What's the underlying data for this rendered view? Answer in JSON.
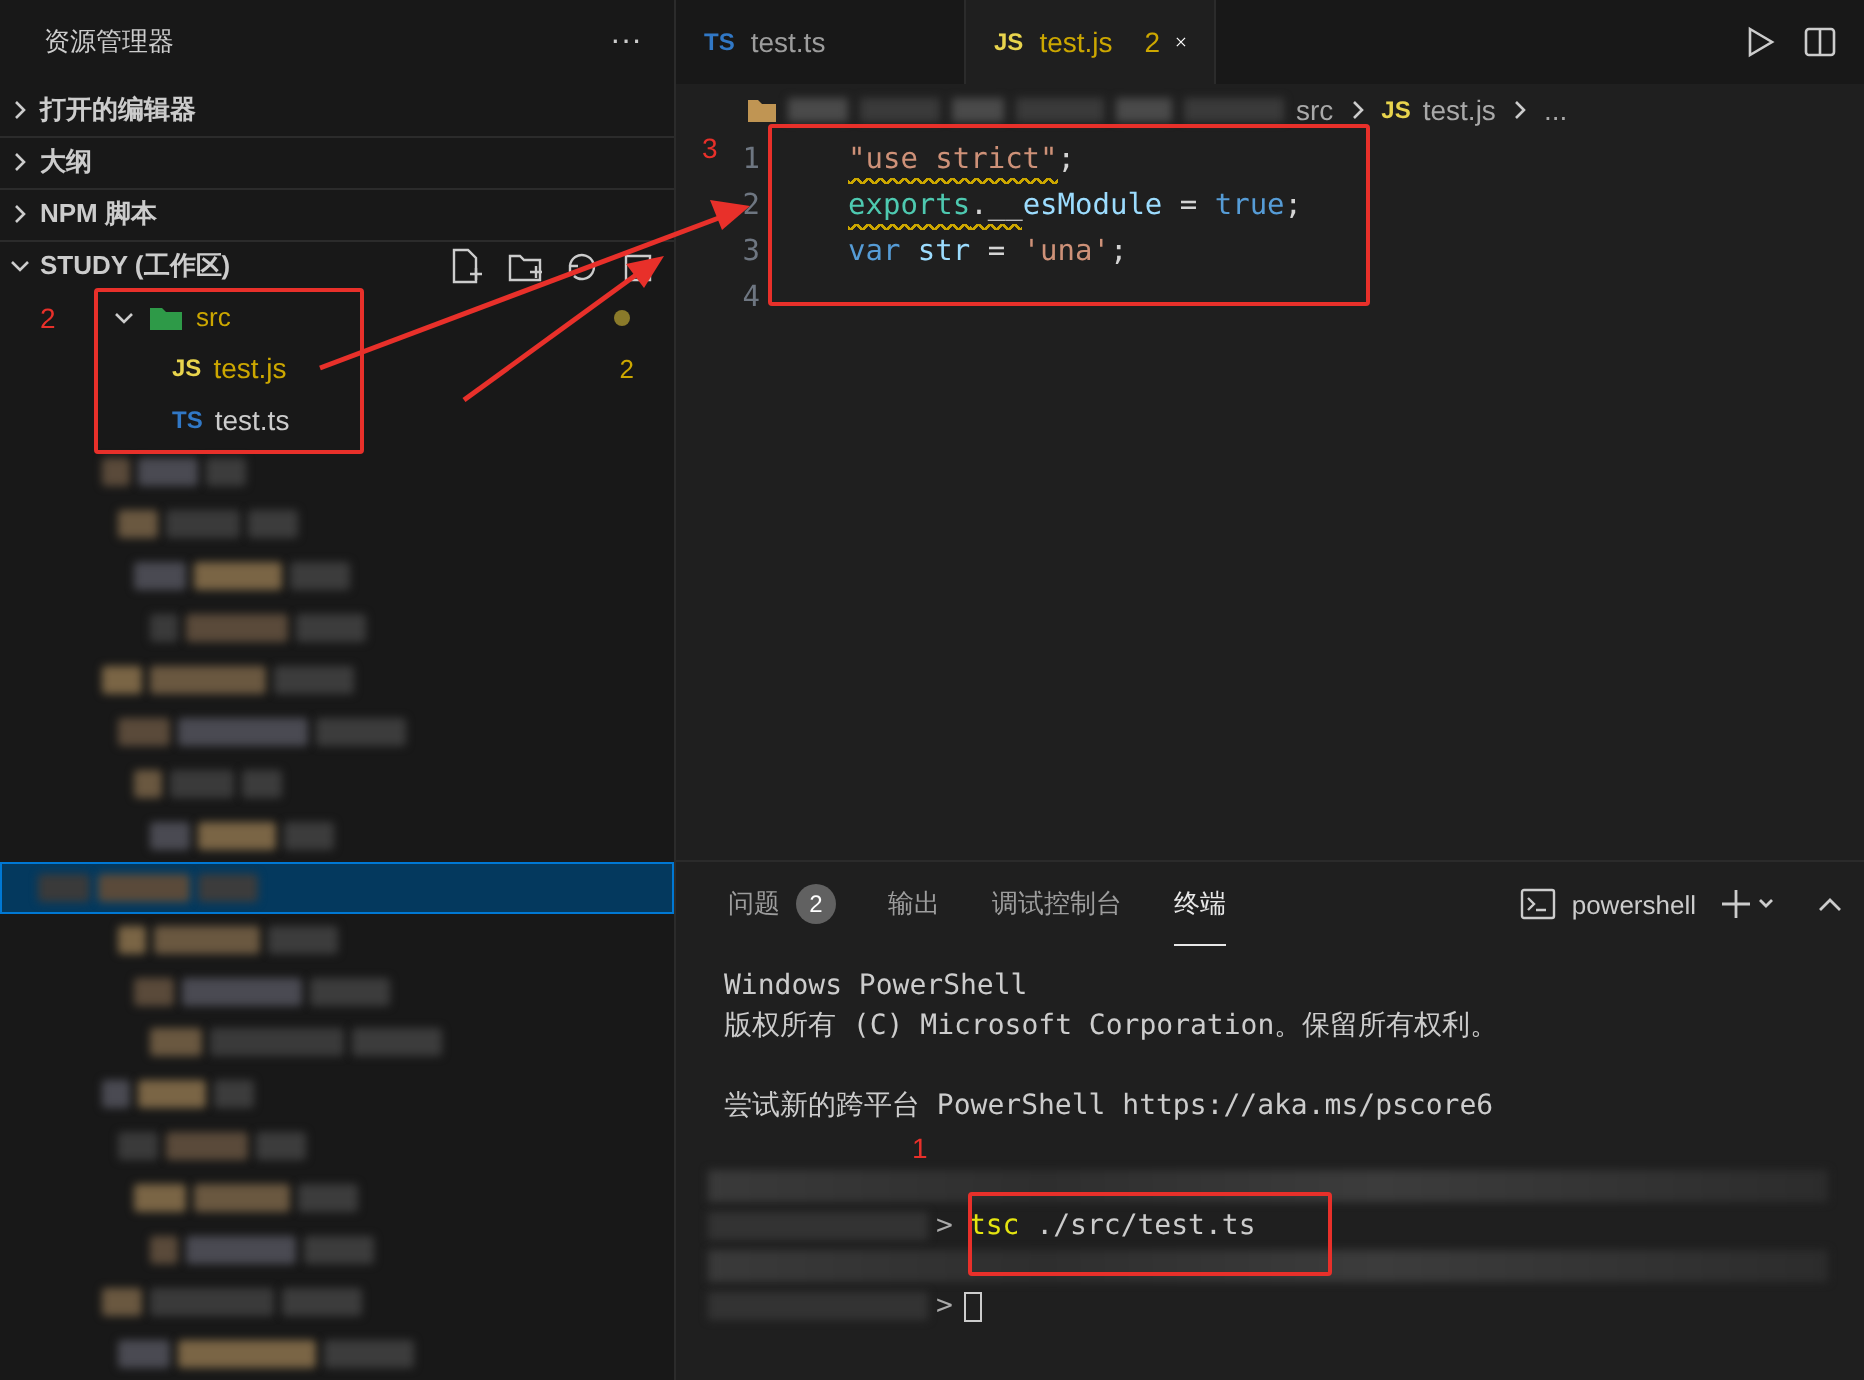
{
  "sidebar": {
    "title": "资源管理器",
    "more": "···",
    "sections": [
      {
        "label": "打开的编辑器",
        "expanded": false
      },
      {
        "label": "大纲",
        "expanded": false
      },
      {
        "label": "NPM 脚本",
        "expanded": false
      }
    ],
    "workspace": {
      "label": "STUDY (工作区)",
      "expanded": true,
      "tree": [
        {
          "name": "src",
          "kind": "folder",
          "expanded": true,
          "modified": true,
          "children": [
            {
              "name": "test.js",
              "kind": "js",
              "icon_label": "JS",
              "badge": "2"
            },
            {
              "name": "test.ts",
              "kind": "ts",
              "icon_label": "TS"
            }
          ]
        }
      ]
    },
    "blurred_rows": [
      {
        "selected": false
      },
      {
        "selected": false
      },
      {
        "selected": false
      },
      {
        "selected": false
      },
      {
        "selected": false
      },
      {
        "selected": false
      },
      {
        "selected": false
      },
      {
        "selected": false
      },
      {
        "selected": true
      },
      {
        "selected": false
      },
      {
        "selected": false
      },
      {
        "selected": false
      },
      {
        "selected": false
      },
      {
        "selected": false
      },
      {
        "selected": false
      },
      {
        "selected": false
      },
      {
        "selected": false
      },
      {
        "selected": false
      }
    ]
  },
  "editor": {
    "tabs": [
      {
        "icon_label": "TS",
        "kind": "ts",
        "label": "test.ts",
        "selected": false
      },
      {
        "icon_label": "JS",
        "kind": "js",
        "label": "test.js",
        "badge": "2",
        "selected": true
      }
    ],
    "breadcrumb": [
      {
        "text": "src"
      },
      {
        "icon_label": "JS",
        "text": "test.js"
      },
      {
        "text": "..."
      }
    ],
    "lines": [
      {
        "number": "1",
        "tokens": [
          {
            "text": "\"use strict\"",
            "kind": "string",
            "squiggle": true
          },
          {
            "text": ";",
            "kind": "plain"
          }
        ]
      },
      {
        "number": "2",
        "tokens": [
          {
            "text": "exports",
            "kind": "module",
            "squiggle": true
          },
          {
            "text": ".__",
            "kind": "plain",
            "squiggle": true
          },
          {
            "text": "esModule",
            "kind": "variable"
          },
          {
            "text": " = ",
            "kind": "plain"
          },
          {
            "text": "true",
            "kind": "keyword"
          },
          {
            "text": ";",
            "kind": "plain"
          }
        ]
      },
      {
        "number": "3",
        "tokens": [
          {
            "text": "var",
            "kind": "keyword"
          },
          {
            "text": " str",
            "kind": "variable"
          },
          {
            "text": " = ",
            "kind": "plain"
          },
          {
            "text": "'una'",
            "kind": "string"
          },
          {
            "text": ";",
            "kind": "plain"
          }
        ]
      },
      {
        "number": "4"
      }
    ]
  },
  "panel": {
    "tabs": [
      {
        "label": "问题",
        "count": "2",
        "selected": false
      },
      {
        "label": "输出",
        "selected": false
      },
      {
        "label": "调试控制台",
        "selected": false
      },
      {
        "label": "终端",
        "selected": true
      }
    ],
    "shell": "powershell",
    "terminal": [
      {
        "kind": "text",
        "text": "Windows PowerShell"
      },
      {
        "kind": "text",
        "text": "版权所有 (C) Microsoft Corporation。保留所有权利。"
      },
      {
        "kind": "blank"
      },
      {
        "kind": "text",
        "text": "尝试新的跨平台 PowerShell https://aka.ms/pscore6"
      },
      {
        "kind": "blank"
      },
      {
        "kind": "blurred"
      },
      {
        "kind": "prompt",
        "prompt": ">",
        "command": "tsc",
        "args": "./src/test.ts"
      },
      {
        "kind": "blurred"
      },
      {
        "kind": "prompt",
        "prompt": ">",
        "cursor": true
      }
    ]
  },
  "annotations": [
    {
      "label": "1"
    },
    {
      "label": "2"
    },
    {
      "label": "3"
    }
  ]
}
